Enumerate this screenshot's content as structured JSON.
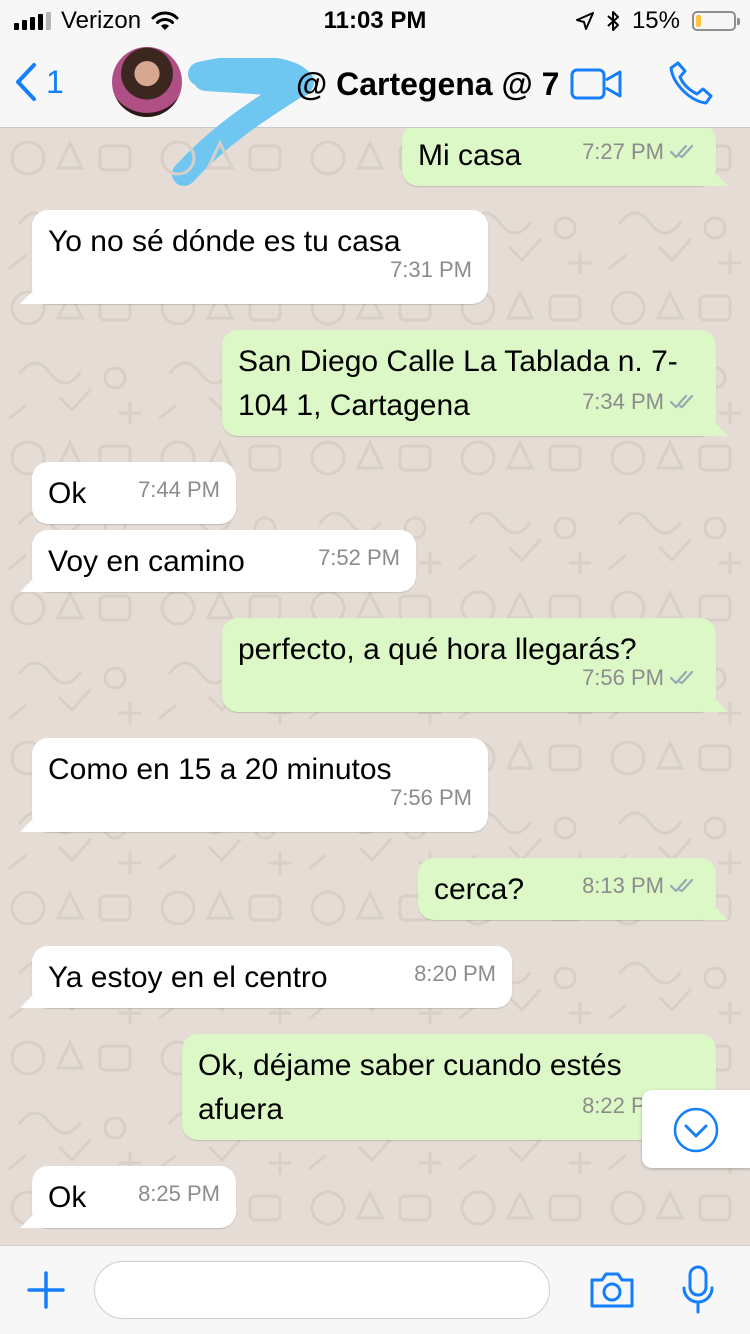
{
  "status_bar": {
    "carrier": "Verizon",
    "time": "11:03 PM",
    "battery_percent": "15%",
    "battery_level": 0.15,
    "icons": [
      "signal-icon",
      "wifi-icon",
      "location-icon",
      "bluetooth-icon",
      "battery-icon"
    ]
  },
  "header": {
    "back_count": "1",
    "title": "@ Cartegena @ 7",
    "icons": [
      "back-chevron-icon",
      "video-call-icon",
      "phone-call-icon"
    ]
  },
  "messages": [
    {
      "direction": "outgoing",
      "text": "Mi casa",
      "time": "7:27 PM",
      "read": true
    },
    {
      "direction": "incoming",
      "text": "Yo no sé dónde es tu casa",
      "time": "7:31 PM"
    },
    {
      "direction": "outgoing",
      "text": "San Diego Calle La Tablada n. 7-104 1, Cartagena",
      "time": "7:34 PM",
      "read": true
    },
    {
      "direction": "incoming",
      "text": "Ok",
      "time": "7:44 PM"
    },
    {
      "direction": "incoming",
      "text": "Voy en camino",
      "time": "7:52 PM"
    },
    {
      "direction": "outgoing",
      "text": "perfecto, a qué hora llegarás?",
      "time": "7:56 PM",
      "read": true
    },
    {
      "direction": "incoming",
      "text": "Como en 15 a 20 minutos",
      "time": "7:56 PM"
    },
    {
      "direction": "outgoing",
      "text": "cerca?",
      "time": "8:13 PM",
      "read": true
    },
    {
      "direction": "incoming",
      "text": "Ya estoy en el centro",
      "time": "8:20 PM"
    },
    {
      "direction": "outgoing",
      "text": "Ok, déjame saber cuando estés afuera",
      "time": "8:22 PM",
      "read": true
    },
    {
      "direction": "incoming",
      "text": "Ok",
      "time": "8:25 PM"
    }
  ],
  "input_bar": {
    "placeholder": "",
    "icons": [
      "plus-icon",
      "camera-icon",
      "microphone-icon"
    ]
  },
  "colors": {
    "accent": "#147efb",
    "outgoing_bubble": "#dcf8c6",
    "incoming_bubble": "#ffffff",
    "wallpaper": "#e5ddd5",
    "read_ticks": "#9aa8b4",
    "battery_low": "#fec23a"
  }
}
